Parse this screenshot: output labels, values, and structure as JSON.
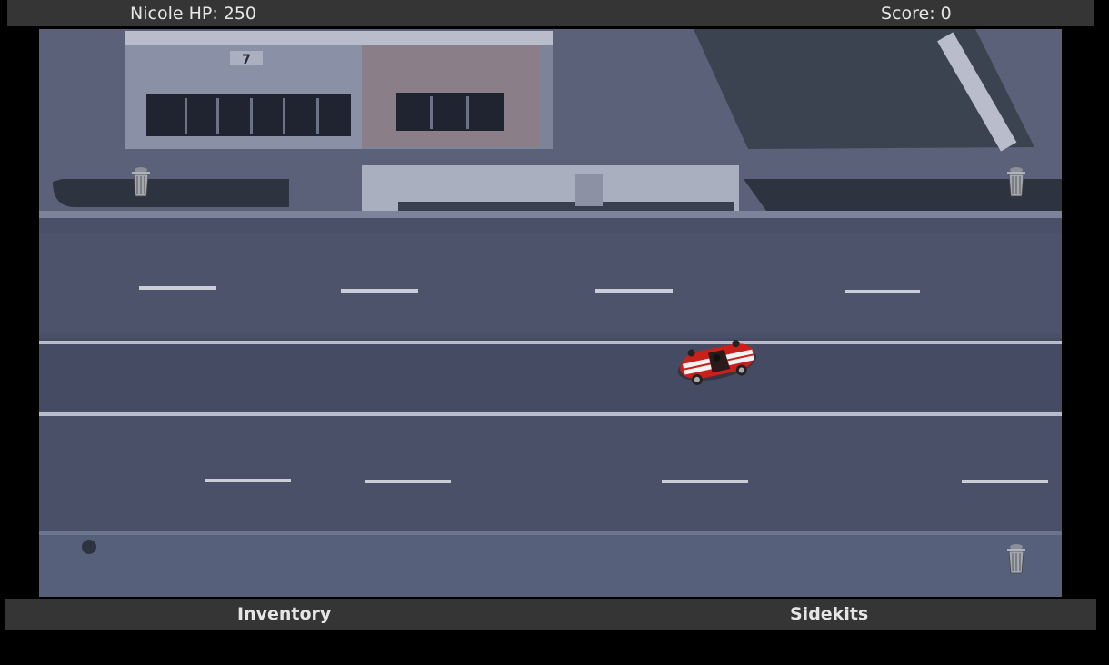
{
  "hud": {
    "hp_text": "Nicole HP: 250",
    "score_text": "Score: 0"
  },
  "bottom_bar": {
    "inventory_label": "Inventory",
    "sidekits_label": "Sidekits"
  },
  "scene": {
    "store_sign": "7",
    "player_car": "red-convertible-with-white-stripes",
    "pickups": [
      "trash-can-icon",
      "trash-can-icon",
      "trash-can-icon"
    ]
  },
  "colors": {
    "hud_bg": "#353535",
    "text": "#e6e6e6",
    "car_red": "#c8201a",
    "road": "#4a5068"
  }
}
